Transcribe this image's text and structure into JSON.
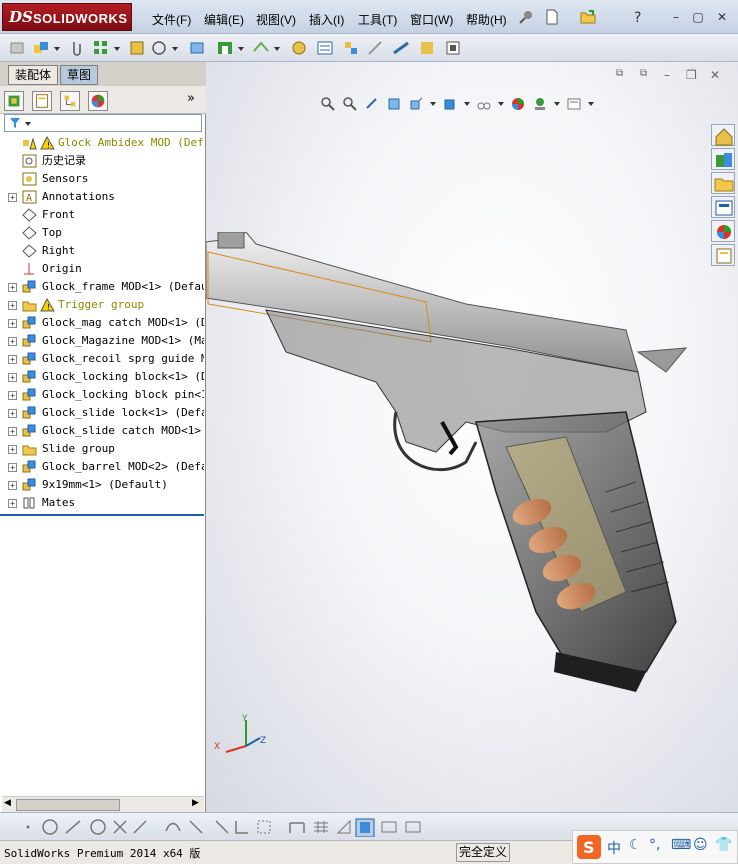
{
  "app": {
    "logo_ds": "DS",
    "logo_name": "SOLIDWORKS"
  },
  "menu": [
    "文件(F)",
    "编辑(E)",
    "视图(V)",
    "插入(I)",
    "工具(T)",
    "窗口(W)",
    "帮助(H)"
  ],
  "left_tabs": [
    "装配体",
    "草图"
  ],
  "tree": [
    {
      "label": "Glock Ambidex MOD  (Default",
      "warn": true,
      "exp": false,
      "icon": "assembly-warning-icon"
    },
    {
      "label": "历史记录",
      "exp": false,
      "icon": "history-icon"
    },
    {
      "label": "Sensors",
      "exp": false,
      "icon": "sensor-icon"
    },
    {
      "label": "Annotations",
      "exp": true,
      "icon": "annotation-icon"
    },
    {
      "label": "Front",
      "exp": false,
      "icon": "plane-icon"
    },
    {
      "label": "Top",
      "exp": false,
      "icon": "plane-icon"
    },
    {
      "label": "Right",
      "exp": false,
      "icon": "plane-icon"
    },
    {
      "label": "Origin",
      "exp": false,
      "icon": "origin-icon"
    },
    {
      "label": "Glock_frame MOD<1> (Default",
      "exp": true,
      "icon": "part-icon"
    },
    {
      "label": "Trigger group",
      "warn": true,
      "exp": true,
      "icon": "folder-warning-icon"
    },
    {
      "label": "Glock_mag catch MOD<1> (Def",
      "exp": true,
      "icon": "part-icon"
    },
    {
      "label": "Glock_Magazine MOD<1> (Mag",
      "exp": true,
      "icon": "part-icon"
    },
    {
      "label": "Glock_recoil sprg guide MOD",
      "exp": true,
      "icon": "part-icon"
    },
    {
      "label": "Glock_locking block<1> (Def",
      "exp": true,
      "icon": "part-icon"
    },
    {
      "label": "Glock_locking block pin<1>",
      "exp": true,
      "icon": "part-icon"
    },
    {
      "label": "Glock_slide lock<1> (Defaul",
      "exp": true,
      "icon": "part-icon"
    },
    {
      "label": "Glock_slide catch MOD<1> (D",
      "exp": true,
      "icon": "part-icon"
    },
    {
      "label": "Slide group",
      "exp": true,
      "icon": "folder-icon"
    },
    {
      "label": "Glock_barrel MOD<2> (Defaul",
      "exp": true,
      "icon": "part-icon"
    },
    {
      "label": "9x19mm<1> (Default)",
      "exp": true,
      "icon": "part-icon"
    },
    {
      "label": "Mates",
      "exp": true,
      "icon": "mates-icon"
    }
  ],
  "triad": {
    "x": "X",
    "y": "Y",
    "z": "Z"
  },
  "status": {
    "left": "SolidWorks Premium 2014 x64 版",
    "right": "完全定义"
  },
  "ime": {
    "lang": "中"
  },
  "colors": {
    "accent": "#1f5fa8",
    "brand": "#b41d24",
    "warning": "#8a8a00"
  }
}
